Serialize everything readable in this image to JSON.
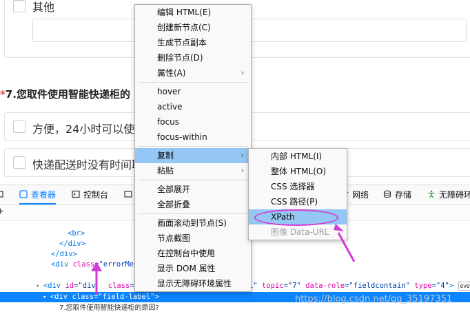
{
  "survey": {
    "option_other": "其他",
    "question_star": "*",
    "question_title": "7.您取件使用智能快递柜的",
    "option_1": "方便，24小时可以使",
    "option_2": "快递配送时没有时间取"
  },
  "devtools": {
    "tabs": [
      {
        "label": "",
        "icon": "inspector-cut-icon"
      },
      {
        "label": "查看器",
        "icon": "inspector-icon"
      },
      {
        "label": "控制台",
        "icon": "console-icon"
      },
      {
        "label": "",
        "icon": "debugger-icon"
      },
      {
        "label": "网络",
        "icon": "network-icon"
      },
      {
        "label": "存储",
        "icon": "storage-icon"
      },
      {
        "label": "无障碍环",
        "icon": "accessibility-icon"
      }
    ],
    "add_symbol": "+",
    "code": {
      "l1": "<br>",
      "l2": "</div>",
      "l3": "</div>",
      "l4_tag": "<div ",
      "l4_attr": "class",
      "l4_val": "=\"errorMes",
      "l5_tri": "▾ ",
      "l5_tag_open": "<div ",
      "l5_attr_id": "id",
      "l5_val_id": "=\"div",
      "l5_attr_class": "class",
      "l5_val_class": "=\"",
      "l5_val_tail": "1\"",
      "l5_attr_topic": "topic",
      "l5_val_topic": "=\"7\"",
      "l5_attr_role": "data-role",
      "l5_val_role": "=\"fieldcontain\"",
      "l5_attr_type": "type",
      "l5_val_type": "=\"4\"",
      "l5_close": ">",
      "l5_badge": "event",
      "l6_tri": "▾ ",
      "l6_tag": "<div ",
      "l6_attr": "class",
      "l6_val": "=\"field-label\"",
      "l6_close": ">",
      "l7_text": "7.您取件使用智能快递柜的原因?"
    },
    "watermark": "https://blog.csdn.net/qq_35197351"
  },
  "context_menu": {
    "items": [
      {
        "label": "编辑 HTML(E)"
      },
      {
        "label": "创建新节点(C)"
      },
      {
        "label": "生成节点副本"
      },
      {
        "label": "删除节点(D)"
      },
      {
        "label": "属性(A)",
        "submenu": "›"
      },
      {
        "label": "hover"
      },
      {
        "label": "active"
      },
      {
        "label": "focus"
      },
      {
        "label": "focus-within"
      },
      {
        "label": "复制",
        "submenu": "›"
      },
      {
        "label": "粘贴",
        "submenu": "›"
      },
      {
        "label": "全部展开"
      },
      {
        "label": "全部折叠"
      },
      {
        "label": "画面滚动到节点(S)"
      },
      {
        "label": "节点截图"
      },
      {
        "label": "在控制台中使用"
      },
      {
        "label": "显示 DOM 属性"
      },
      {
        "label": "显示无障碍环境属性"
      }
    ]
  },
  "copy_submenu": {
    "items": [
      {
        "label": "内部 HTML(I)"
      },
      {
        "label": "整体 HTML(O)"
      },
      {
        "label": "CSS 选择器"
      },
      {
        "label": "CSS 路径(P)"
      },
      {
        "label": "XPath"
      },
      {
        "label": "图像 Data-URL"
      }
    ]
  },
  "colors": {
    "accent": "#0a84ff",
    "menu_highlight": "#95c7f4",
    "annotation": "#d63ad6"
  }
}
